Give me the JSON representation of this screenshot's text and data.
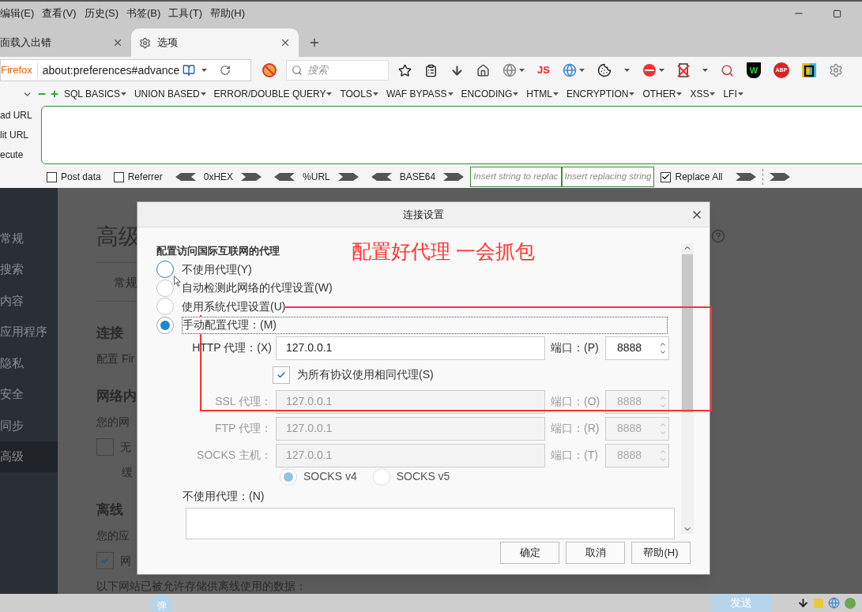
{
  "menu_bar": [
    "编辑(E)",
    "查看(V)",
    "历史(S)",
    "书签(B)",
    "工具(T)",
    "帮助(H)"
  ],
  "tabs": [
    {
      "label": "面载入出错",
      "selected": false
    },
    {
      "label": "选项",
      "selected": true
    }
  ],
  "nav": {
    "identity": "Firefox",
    "url": "about:preferences#advance",
    "search_placeholder": "搜索",
    "badges": [
      "JS",
      "W",
      "ABP"
    ]
  },
  "hackbar": {
    "menus": [
      "SQL BASICS",
      "UNION BASED",
      "ERROR/DOUBLE QUERY",
      "TOOLS",
      "WAF BYPASS",
      "ENCODING",
      "HTML",
      "ENCRYPTION",
      "OTHER",
      "XSS",
      "LFI"
    ],
    "side_actions": [
      "ad URL",
      "lit URL",
      "ecute"
    ],
    "options": [
      {
        "kind": "checkbox",
        "label": "Post data",
        "checked": false
      },
      {
        "kind": "checkbox",
        "label": "Referrer",
        "checked": false
      },
      {
        "kind": "encoder",
        "label": "0xHEX"
      },
      {
        "kind": "encoder",
        "label": "%URL"
      },
      {
        "kind": "encoder",
        "label": "BASE64"
      },
      {
        "kind": "field",
        "placeholder": "Insert string to replac"
      },
      {
        "kind": "field",
        "placeholder": "Insert replacing string"
      },
      {
        "kind": "checkbox",
        "label": "Replace All",
        "checked": true
      },
      {
        "kind": "arrows"
      }
    ]
  },
  "sidebar": [
    {
      "label": "常规",
      "selected": false
    },
    {
      "label": "搜索",
      "selected": false
    },
    {
      "label": "内容",
      "selected": false
    },
    {
      "label": "应用程序",
      "selected": false
    },
    {
      "label": "隐私",
      "selected": false
    },
    {
      "label": "安全",
      "selected": false
    },
    {
      "label": "同步",
      "selected": false
    },
    {
      "label": "高级",
      "selected": true
    }
  ],
  "page": {
    "title": "高级",
    "tab": "常规",
    "lines": [
      {
        "kind": "heading",
        "text": "连接"
      },
      {
        "kind": "text",
        "text": "配置 Fir"
      },
      {
        "kind": "heading",
        "text": "网络内"
      },
      {
        "kind": "text",
        "text": "您的网"
      },
      {
        "kind": "checkbox",
        "text": "无",
        "checked": false
      },
      {
        "kind": "subtext",
        "text": "缓"
      },
      {
        "kind": "heading",
        "text": "离线"
      },
      {
        "kind": "text",
        "text": "您的应"
      },
      {
        "kind": "checkbox",
        "text": "网",
        "checked": true
      },
      {
        "kind": "text",
        "text": "以下网站已被允许存储供离线使用的数据："
      }
    ]
  },
  "dialog": {
    "title": "连接设置",
    "heading": "配置访问国际互联网的代理",
    "modes": [
      {
        "label": "不使用代理(Y)",
        "selected": false
      },
      {
        "label": "自动检测此网络的代理设置(W)",
        "selected": false
      },
      {
        "label": "使用系统代理设置(U)",
        "selected": false
      },
      {
        "label": "手动配置代理：(M)",
        "selected": true
      }
    ],
    "proxies": [
      {
        "label": "HTTP 代理：(X)",
        "host": "127.0.0.1",
        "port_label": "端口：(P)",
        "port": "8888",
        "disabled": false
      },
      {
        "label": "SSL 代理：",
        "host": "127.0.0.1",
        "port_label": "端口：(O)",
        "port": "8888",
        "disabled": true
      },
      {
        "label": "FTP 代理：",
        "host": "127.0.0.1",
        "port_label": "端口：(R)",
        "port": "8888",
        "disabled": true
      },
      {
        "label": "SOCKS 主机：",
        "host": "127.0.0.1",
        "port_label": "端口：(T)",
        "port": "8888",
        "disabled": true
      }
    ],
    "same_proxy": {
      "label": "为所有协议使用相同代理(S)",
      "checked": true
    },
    "socks_versions": [
      {
        "label": "SOCKS v4",
        "selected": true
      },
      {
        "label": "SOCKS v5",
        "selected": false
      }
    ],
    "no_proxy_label": "不使用代理：(N)",
    "buttons": [
      "确定",
      "取消",
      "帮助(H)"
    ]
  },
  "annotation": "配置好代理 一会抓包",
  "bottom_bar": {
    "badge": "弹",
    "send": "发送"
  }
}
